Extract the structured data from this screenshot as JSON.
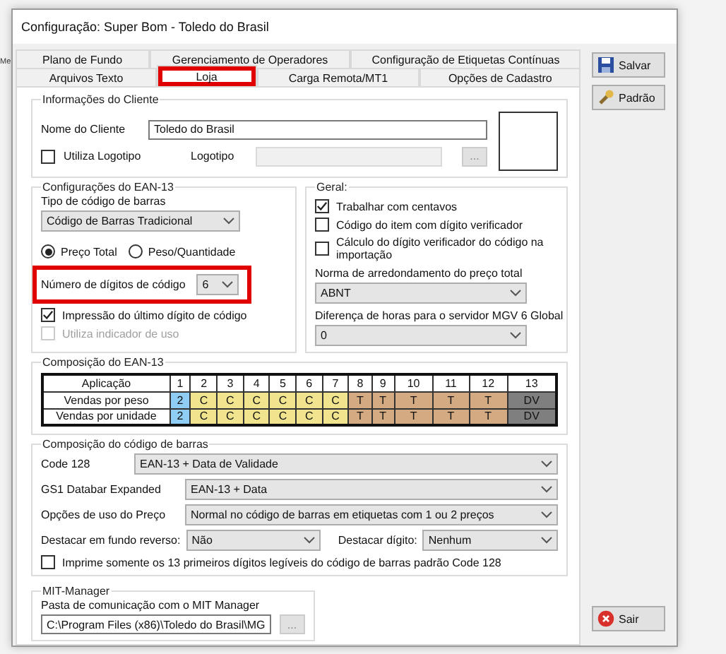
{
  "background_text": "Me",
  "window": {
    "title": "Configuração: Super Bom - Toledo do Brasil"
  },
  "tab_rows": [
    {
      "tabs": [
        {
          "label": "Plano de Fundo",
          "selected": false,
          "highlighted": false
        },
        {
          "label": "Gerenciamento de Operadores",
          "selected": false,
          "highlighted": false
        },
        {
          "label": "Configuração de Etiquetas Contínuas",
          "selected": false,
          "highlighted": false
        }
      ]
    },
    {
      "tabs": [
        {
          "label": "Arquivos Texto",
          "selected": false,
          "highlighted": false
        },
        {
          "label": "Loja",
          "selected": true,
          "highlighted": true
        },
        {
          "label": "Carga Remota/MT1",
          "selected": false,
          "highlighted": false
        },
        {
          "label": "Opções de Cadastro",
          "selected": false,
          "highlighted": false
        }
      ]
    }
  ],
  "buttons": [
    {
      "label": "Salvar",
      "kind": "save"
    },
    {
      "label": "Padrão",
      "kind": "default"
    },
    {
      "label": "Sair",
      "kind": "exit"
    }
  ],
  "client_info": {
    "legend": "Informações do Cliente",
    "name_label": "Nome do Cliente",
    "name_value": "Toledo do Brasil",
    "logo_checkbox": {
      "label": "Utiliza Logotipo",
      "checked": false
    },
    "logo_label": "Logotipo",
    "browse": "..."
  },
  "ean13_config": {
    "legend": "Configurações do EAN-13",
    "type_label": "Tipo de código de barras",
    "type_value": "Código de Barras Tradicional",
    "radios": [
      {
        "label": "Preço Total",
        "selected": true
      },
      {
        "label": "Peso/Quantidade",
        "selected": false
      }
    ],
    "digits": {
      "label": "Número de dígitos de código",
      "value": "6",
      "highlighted": true
    },
    "checkboxes": [
      {
        "label": "Impressão do último dígito de código",
        "checked": true,
        "disabled": false
      },
      {
        "label": "Utiliza indicador de uso",
        "checked": false,
        "disabled": true
      }
    ]
  },
  "general": {
    "legend": "Geral:",
    "checkboxes": [
      {
        "label": "Trabalhar com centavos",
        "checked": true
      },
      {
        "label": "Código do item com dígito verificador",
        "checked": false
      },
      {
        "label": "Cálculo do dígito verificador do código na importação",
        "checked": false
      }
    ],
    "fields": [
      {
        "label": "Norma de arredondamento do preço total",
        "value": "ABNT"
      },
      {
        "label": "Diferença de horas para o servidor MGV 6 Global",
        "value": "0"
      }
    ]
  },
  "composition": {
    "legend": "Composição do EAN-13",
    "row_header": "Aplicação",
    "columns": [
      "1",
      "2",
      "3",
      "4",
      "5",
      "6",
      "7",
      "8",
      "9",
      "10",
      "11",
      "12",
      "13"
    ],
    "rows": [
      {
        "label": "Vendas por peso",
        "cells": [
          {
            "text": "2",
            "color": "#8fcdf5"
          },
          {
            "text": "C",
            "color": "#f0e58e"
          },
          {
            "text": "C",
            "color": "#f0e58e"
          },
          {
            "text": "C",
            "color": "#f0e58e"
          },
          {
            "text": "C",
            "color": "#f0e58e"
          },
          {
            "text": "C",
            "color": "#f0e58e"
          },
          {
            "text": "C",
            "color": "#f0e58e"
          },
          {
            "text": "T",
            "color": "#d3aa82"
          },
          {
            "text": "T",
            "color": "#d3aa82"
          },
          {
            "text": "T",
            "color": "#d3aa82"
          },
          {
            "text": "T",
            "color": "#d3aa82"
          },
          {
            "text": "T",
            "color": "#d3aa82"
          },
          {
            "text": "DV",
            "color": "#7f7f7f"
          }
        ]
      },
      {
        "label": "Vendas por unidade",
        "cells": [
          {
            "text": "2",
            "color": "#8fcdf5"
          },
          {
            "text": "C",
            "color": "#f0e58e"
          },
          {
            "text": "C",
            "color": "#f0e58e"
          },
          {
            "text": "C",
            "color": "#f0e58e"
          },
          {
            "text": "C",
            "color": "#f0e58e"
          },
          {
            "text": "C",
            "color": "#f0e58e"
          },
          {
            "text": "C",
            "color": "#f0e58e"
          },
          {
            "text": "T",
            "color": "#d3aa82"
          },
          {
            "text": "T",
            "color": "#d3aa82"
          },
          {
            "text": "T",
            "color": "#d3aa82"
          },
          {
            "text": "T",
            "color": "#d3aa82"
          },
          {
            "text": "T",
            "color": "#d3aa82"
          },
          {
            "text": "DV",
            "color": "#7f7f7f"
          }
        ]
      }
    ]
  },
  "barcode": {
    "legend": "Composição do código de barras",
    "fields": [
      {
        "label": "Code 128",
        "value": "EAN-13 + Data de Validade"
      },
      {
        "label": "GS1 Databar Expanded",
        "value": "EAN-13 + Data"
      },
      {
        "label": "Opções de uso do Preço",
        "value": "Normal no código de barras em etiquetas com 1 ou 2 preços"
      }
    ],
    "inline_fields": [
      {
        "label": "Destacar em fundo reverso:",
        "value": "Não"
      },
      {
        "label": "Destacar dígito:",
        "value": "Nenhum"
      }
    ],
    "checkbox": {
      "label": "Imprime somente os 13 primeiros dígitos legíveis do código de barras padrão Code 128",
      "checked": false
    }
  },
  "mit": {
    "legend": "MIT-Manager",
    "label": "Pasta de comunicação com o MIT Manager",
    "value": "C:\\Program Files (x86)\\Toledo do Brasil\\MG",
    "browse": "..."
  }
}
